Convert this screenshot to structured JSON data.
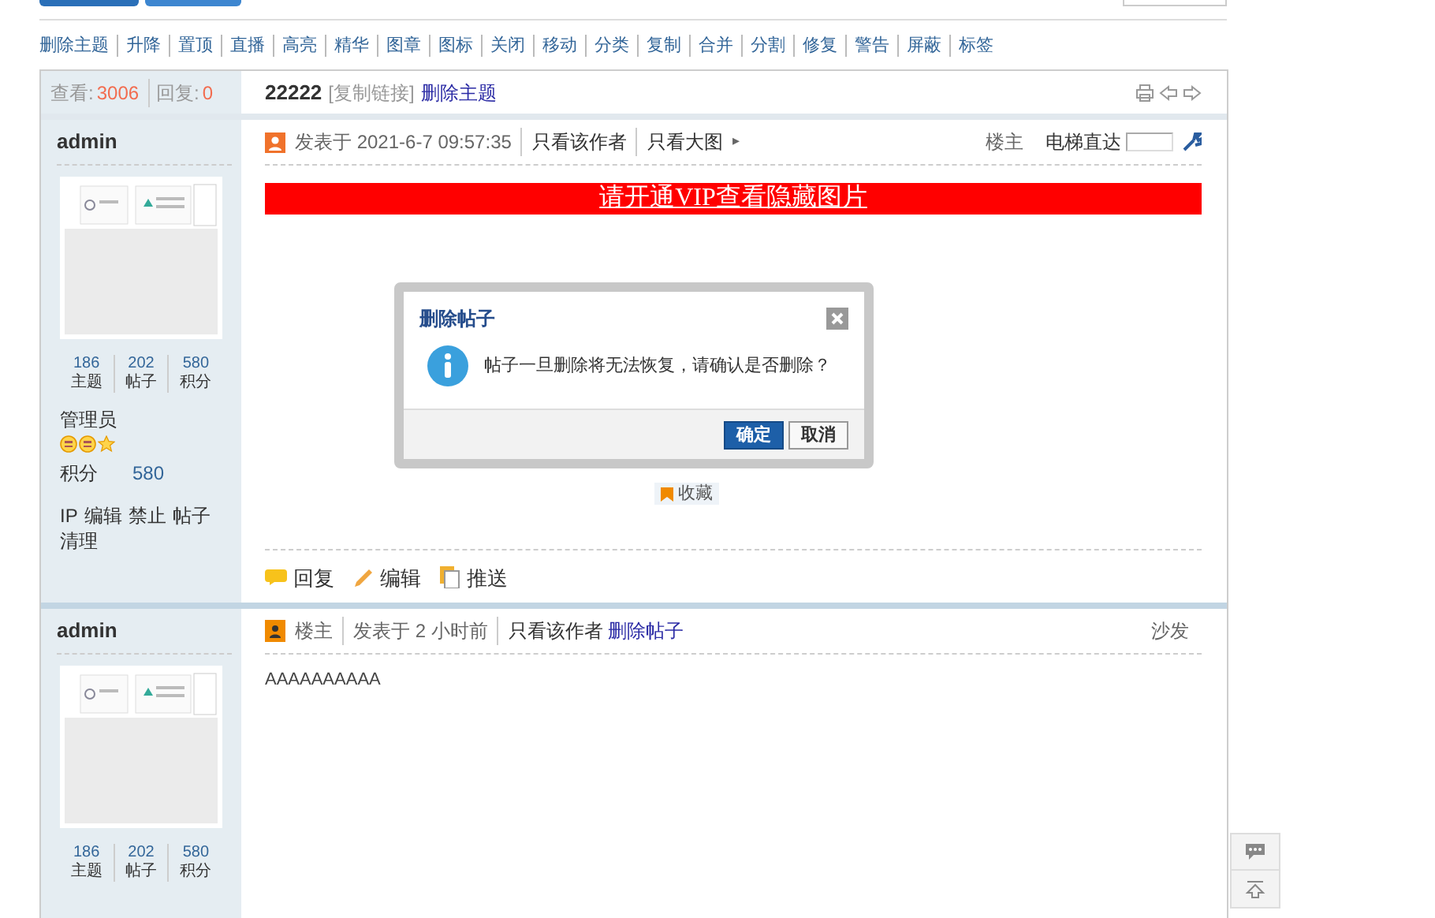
{
  "mod_actions": [
    "删除主题",
    "升降",
    "置顶",
    "直播",
    "高亮",
    "精华",
    "图章",
    "图标",
    "关闭",
    "移动",
    "分类",
    "复制",
    "合并",
    "分割",
    "修复",
    "警告",
    "屏蔽",
    "标签"
  ],
  "thread": {
    "views_label": "查看:",
    "views": "3006",
    "replies_label": "回复:",
    "replies": "0",
    "title": "22222",
    "copy_link": "[复制链接]",
    "delete_link": "删除主题"
  },
  "posts": [
    {
      "author": "admin",
      "stats": [
        {
          "value": "186",
          "label": "主题"
        },
        {
          "value": "202",
          "label": "帖子"
        },
        {
          "value": "580",
          "label": "积分"
        }
      ],
      "group": "管理员",
      "stars": 3,
      "credits_label": "积分",
      "credits": "580",
      "admin_links": [
        "IP",
        "编辑",
        "禁止",
        "帖子",
        "清理"
      ],
      "header_items": [
        {
          "kind": "posted",
          "text": "发表于 2021-6-7 09:57:35"
        },
        {
          "kind": "link",
          "text": "只看该作者"
        },
        {
          "kind": "link",
          "text": "只看大图"
        },
        {
          "kind": "arrow",
          "text": "▸"
        }
      ],
      "floor": "楼主",
      "jump_label": "电梯直达",
      "banner": "请开通VIP查看隐藏图片",
      "collect": "收藏",
      "actions": [
        {
          "kind": "reply",
          "label": "回复"
        },
        {
          "kind": "edit",
          "label": "编辑"
        },
        {
          "kind": "push",
          "label": "推送"
        }
      ]
    },
    {
      "author": "admin",
      "stats": [
        {
          "value": "186",
          "label": "主题"
        },
        {
          "value": "202",
          "label": "帖子"
        },
        {
          "value": "580",
          "label": "积分"
        }
      ],
      "header_items": [
        {
          "kind": "floor",
          "text": "楼主"
        },
        {
          "kind": "posted",
          "text": "发表于 2 小时前"
        },
        {
          "kind": "link",
          "text": "只看该作者"
        },
        {
          "kind": "delete",
          "text": "删除帖子"
        }
      ],
      "floor": "沙发",
      "body": "AAAAAAAAAA"
    }
  ],
  "dialog": {
    "title": "删除帖子",
    "message": "帖子一旦删除将无法恢复，请确认是否删除？",
    "buttons": [
      {
        "label": "确定",
        "primary": true
      },
      {
        "label": "取消",
        "primary": false
      }
    ]
  }
}
